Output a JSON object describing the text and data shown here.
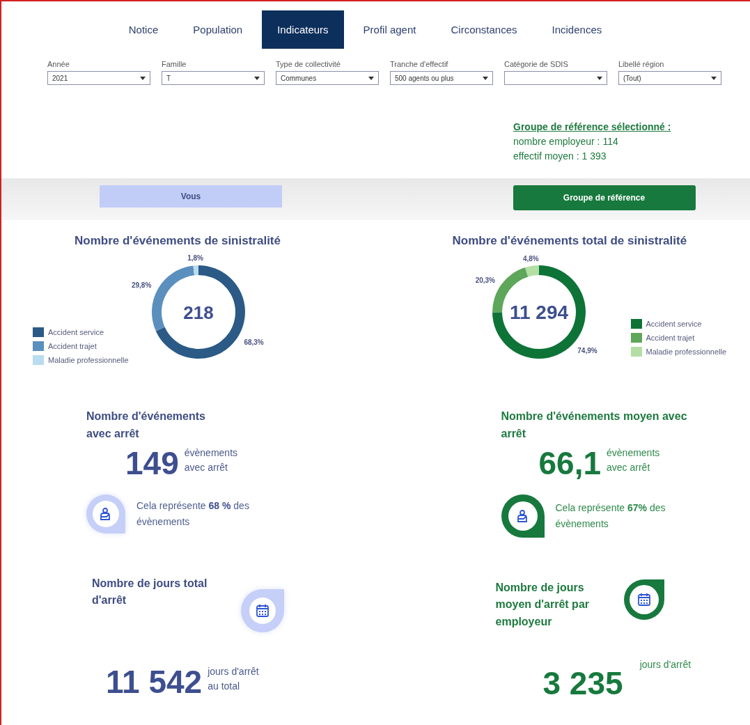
{
  "tabs": [
    {
      "label": "Notice",
      "selected": false
    },
    {
      "label": "Population",
      "selected": false
    },
    {
      "label": "Indicateurs",
      "selected": true
    },
    {
      "label": "Profil agent",
      "selected": false
    },
    {
      "label": "Circonstances",
      "selected": false
    },
    {
      "label": "Incidences",
      "selected": false
    }
  ],
  "filters": [
    {
      "label": "Année",
      "value": "2021"
    },
    {
      "label": "Famille",
      "value": "T"
    },
    {
      "label": "Type de collectivité",
      "value": "Communes"
    },
    {
      "label": "Tranche d'effectif",
      "value": "500 agents ou plus"
    },
    {
      "label": "Catégorie de SDIS"
    },
    {
      "label": "Libellé région",
      "value": "(Tout)"
    }
  ],
  "reference_group": {
    "title": "Groupe de référence sélectionné :",
    "lines": [
      "nombre employeur : 114",
      "effectif moyen : 1 393"
    ]
  },
  "panels": [
    {
      "kind": "you",
      "header": "Vous",
      "donut_title": "Nombre d'événements de sinistralité",
      "total": "218",
      "legend": [
        {
          "color": "#2b5a86"
        },
        {
          "color": "#5b8fbe"
        },
        {
          "color": "#b9dcef"
        }
      ],
      "chart_data": {
        "type": "donut",
        "categories": [
          "Accident service",
          "Accident trajet",
          "Maladie professionnelle"
        ],
        "values": [
          68.3,
          29.8,
          1.8
        ],
        "value_labels": [
          "68,3%",
          "29,8%",
          "1,8%"
        ]
      },
      "events": {
        "title": "Nombre d'événements avec arrêt",
        "value": "149",
        "unit": [
          "évènements",
          "avec arrêt"
        ],
        "note": "Cela représente **68 %** des évènements"
      },
      "days": {
        "title": "Nombre de jours total d'arrêt",
        "value": "11 542",
        "unit": [
          "jours d'arrêt",
          "au total"
        ]
      }
    },
    {
      "kind": "reference",
      "header": "Groupe de référence",
      "donut_title": "Nombre d'événements total de sinistralité",
      "total": "11 294",
      "legend": [
        {
          "color": "#0d7337"
        },
        {
          "color": "#5ea65a"
        },
        {
          "color": "#b3dea4"
        }
      ],
      "chart_data": {
        "type": "donut",
        "categories": [
          "Accident service",
          "Accident trajet",
          "Maladie professionnelle"
        ],
        "values": [
          74.9,
          20.3,
          4.8
        ],
        "value_labels": [
          "74,9%",
          "20,3%",
          "4,8%"
        ]
      },
      "events": {
        "title": "Nombre d'événements moyen avec arrêt",
        "value": "66,1",
        "unit": [
          "évènements",
          "avec arrêt"
        ],
        "note": "Cela représente **67%** des évènements"
      },
      "days": {
        "title": "Nombre de jours moyen d'arrêt par employeur",
        "value": "3 235",
        "unit": [
          "jours d'arrêt"
        ]
      }
    }
  ]
}
